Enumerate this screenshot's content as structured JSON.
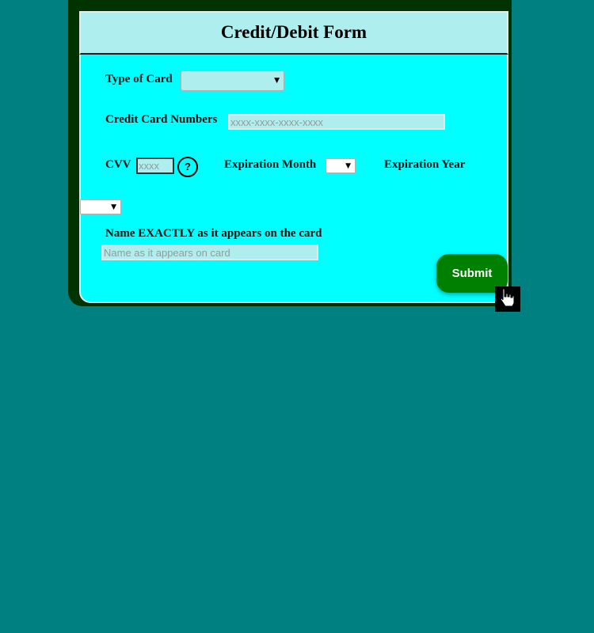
{
  "form": {
    "title": "Credit/Debit Form",
    "type_of_card_label": "Type of Card",
    "type_of_card_value": "",
    "card_numbers_label": "Credit Card Numbers",
    "card_numbers_placeholder": "xxxx-xxxx-xxxx-xxxx",
    "cvv_label": "CVV",
    "cvv_placeholder": "xxxx",
    "help_symbol": "?",
    "expiration_month_label": "Expiration Month",
    "expiration_month_value": "",
    "expiration_year_label": "Expiration Year",
    "expiration_year_value": "",
    "name_label": "Name EXACTLY as it appears on the card",
    "name_placeholder": "Name as it appears on card",
    "submit_label": "Submit",
    "dropdown_arrow": "▼"
  },
  "colors": {
    "page_background": "#008080",
    "frame": "#013301",
    "form_background": "#00ffff",
    "header_background": "#afeeee",
    "input_background": "#afeeee",
    "submit_background": "#008000"
  },
  "icons": {
    "help": "question-circle-icon",
    "dropdown": "chevron-down-icon",
    "cursor": "hand-pointer-icon"
  }
}
